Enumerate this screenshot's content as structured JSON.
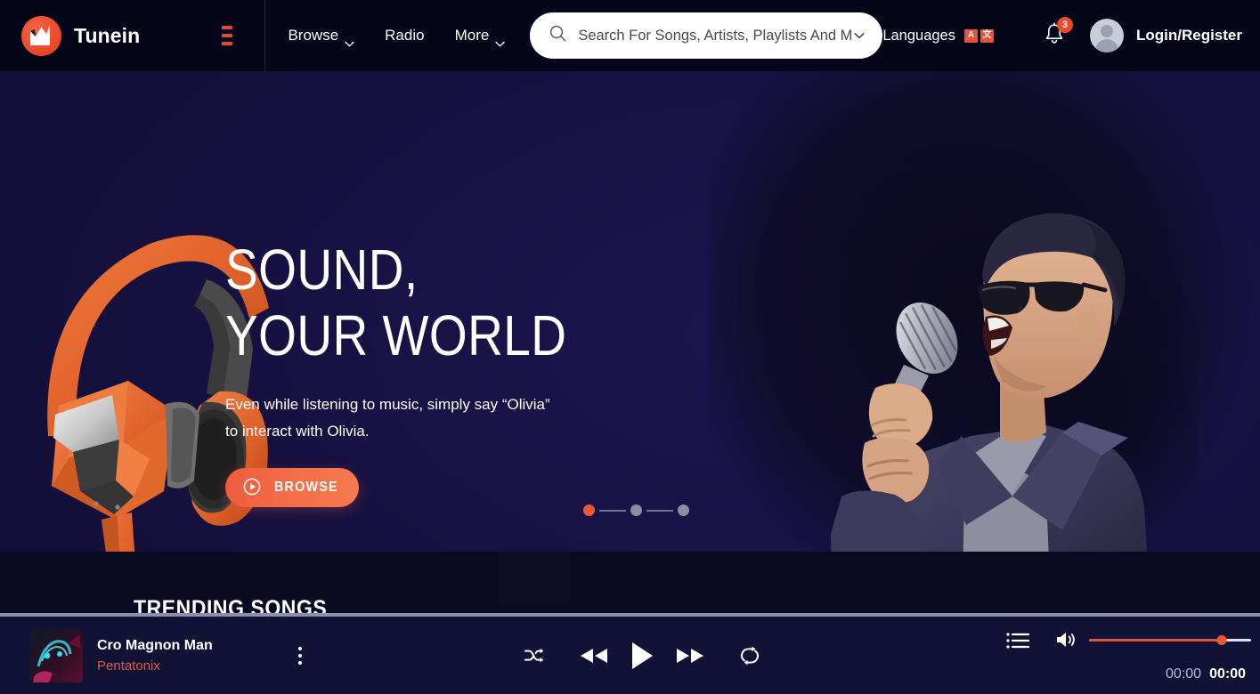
{
  "brand": {
    "name": "Tunein",
    "logo_icon": "m-logo-icon",
    "logo_color": "#ec4a2c"
  },
  "header": {
    "menu_icon": "hamburger-menu-icon",
    "nav": [
      {
        "label": "Browse",
        "icon": "chevron-down-icon",
        "has_caret": true
      },
      {
        "label": "Radio",
        "icon": "",
        "has_caret": false
      },
      {
        "label": "More",
        "icon": "chevron-down-icon",
        "has_caret": true
      }
    ],
    "search": {
      "icon": "search-icon",
      "placeholder": "Search For Songs, Artists, Playlists And More.",
      "value": "",
      "caret_icon": "chevron-down-icon"
    },
    "languages": {
      "label": "Languages",
      "icon": "translate-icon",
      "badge_a": "A",
      "badge_b": "文"
    },
    "notifications": {
      "icon": "bell-icon",
      "count": "3"
    },
    "account": {
      "avatar_icon": "avatar-icon",
      "label": "Login/Register"
    }
  },
  "hero": {
    "title_line1": "SOUND,",
    "title_line2": "YOUR WORLD",
    "subtitle_line1": "Even while listening to music, simply say “Olivia”",
    "subtitle_line2": "to interact with Olivia.",
    "cta": {
      "label": "BROWSE",
      "icon": "play-circle-icon",
      "color": "#ef5b3c"
    },
    "headphones_image": "orange-headphones-image",
    "singer_image": "singer-with-microphone-image",
    "background_color": "#161242",
    "carousel": {
      "active_index": 0,
      "slides": [
        "1",
        "2",
        "3"
      ]
    }
  },
  "below_hero": {
    "section_title": "TRENDING SONGS"
  },
  "player": {
    "progress_percent": 0,
    "now_playing": {
      "title": "Cro Magnon Man",
      "artist": "Pentatonix",
      "artwork": "album-artwork-image",
      "more_icon": "more-vertical-icon"
    },
    "controls": {
      "shuffle": "shuffle-icon",
      "previous": "rewind-icon",
      "play": "play-icon",
      "next": "fast-forward-icon",
      "repeat": "repeat-icon"
    },
    "playlist_icon": "playlist-icon",
    "volume": {
      "icon": "volume-high-icon",
      "level_percent": 82,
      "fill_color": "#e0523a"
    },
    "time_current": "00:00",
    "time_duration": "00:00"
  }
}
